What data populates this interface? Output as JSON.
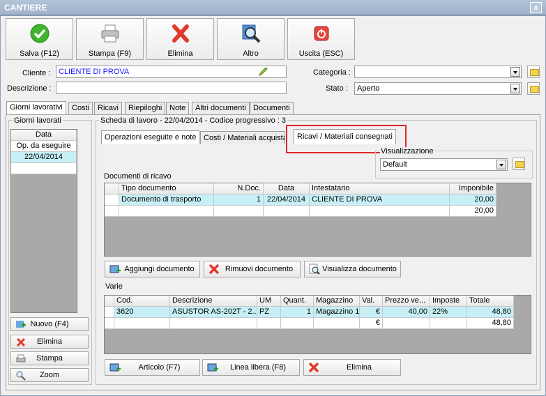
{
  "window": {
    "title": "CANTIERE",
    "close": "x"
  },
  "toolbar": {
    "save": "Salva (F12)",
    "print": "Stampa (F9)",
    "delete": "Elimina",
    "other": "Altro",
    "exit": "Uscita (ESC)"
  },
  "form": {
    "cliente_label": "Cliente :",
    "cliente_value": "CLIENTE DI PROVA",
    "descrizione_label": "Descrizione :",
    "descrizione_value": "",
    "categoria_label": "Categoria :",
    "categoria_value": "",
    "stato_label": "Stato :",
    "stato_value": "Aperto"
  },
  "tabs": [
    "Giorni lavorativi",
    "Costi",
    "Ricavi",
    "Riepiloghi",
    "Note",
    "Altri documenti",
    "Documenti"
  ],
  "left": {
    "group": "Giorni lavorati",
    "header": "Data",
    "items": [
      "Op. da eseguire",
      "22/04/2014"
    ],
    "new": "Nuovo (F4)",
    "delete": "Elimina",
    "print": "Stampa",
    "zoom": "Zoom"
  },
  "scheda": {
    "title": "Scheda di lavoro - 22/04/2014 - Codice progressivo : 3"
  },
  "subtabs": [
    "Operazioni eseguite e note",
    "Costi / Materiali acquistati",
    "Ricavi / Materiali consegnati"
  ],
  "vis": {
    "label": "Visualizzazione",
    "value": "Default"
  },
  "docs": {
    "label": "Documenti di ricavo",
    "headers": [
      "Tipo documento",
      "N.Doc.",
      "Data",
      "Intestatario",
      "Imponibile"
    ],
    "rows": [
      [
        "Documento di trasporto",
        "1",
        "22/04/2014",
        "CLIENTE DI PROVA",
        "20,00"
      ]
    ],
    "total": "20,00",
    "add": "Aggiungi documento",
    "remove": "Rimuovi documento",
    "view": "Visualizza documento"
  },
  "varie": {
    "label": "Varie",
    "headers": [
      "Cod.",
      "Descrizione",
      "UM",
      "Quant.",
      "Magazzino",
      "Val.",
      "Prezzo ve...",
      "Imposte",
      "Totale"
    ],
    "rows": [
      [
        "3620",
        "ASUSTOR AS-202T - 2...",
        "PZ",
        "1",
        "Magazzino 1",
        "€",
        "40,00",
        "22%",
        "48,80"
      ]
    ],
    "total_val": "€",
    "total": "48,80",
    "article": "Articolo (F7)",
    "free": "Linea libera (F8)",
    "delete": "Elimina"
  },
  "colors": {
    "selected_row": "#c6f0f6",
    "highlight": "#e0262c",
    "title_bar": "#a9bbd1"
  }
}
